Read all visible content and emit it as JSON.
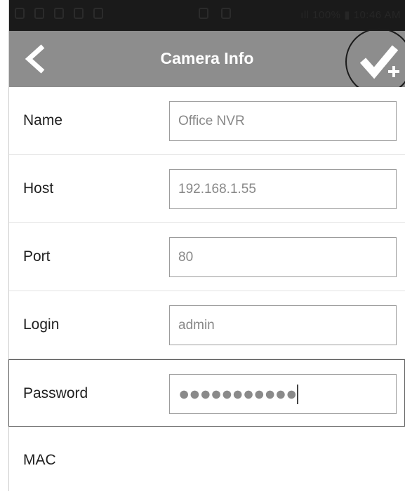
{
  "title_bar": {
    "title": "Camera Info",
    "back_icon": "chevron-left-icon",
    "save_icon": "check-plus-icon"
  },
  "status_bar": {
    "right_text": "ıll 100% ▮ 10:46 AM"
  },
  "form": {
    "fields": [
      {
        "label": "Name",
        "value": "Office NVR"
      },
      {
        "label": "Host",
        "value": "192.168.1.55"
      },
      {
        "label": "Port",
        "value": "80"
      },
      {
        "label": "Login",
        "value": "admin"
      },
      {
        "label": "Password",
        "masked_value": "●●●●●●●●●●●"
      },
      {
        "label": "MAC"
      }
    ]
  },
  "colors": {
    "title_bar": "#8d8d8d",
    "status_bar": "#1a1a1a",
    "field_border": "#9c9c9c"
  }
}
